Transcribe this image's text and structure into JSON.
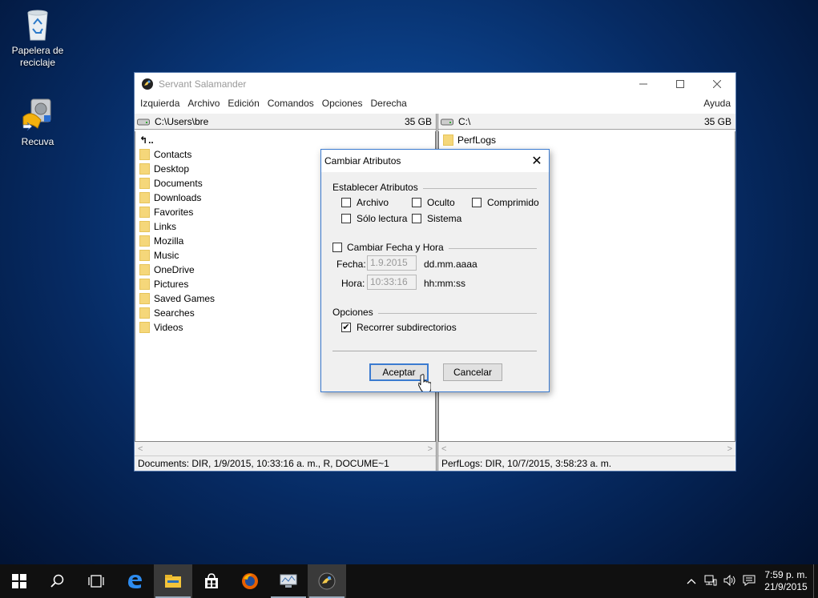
{
  "desktop": {
    "icons": [
      {
        "label": "Papelera de reciclaje"
      },
      {
        "label": "Recuva"
      }
    ]
  },
  "window": {
    "title": "Servant Salamander",
    "menu": [
      "Izquierda",
      "Archivo",
      "Edición",
      "Comandos",
      "Opciones",
      "Derecha"
    ],
    "menu_help": "Ayuda",
    "left": {
      "path": "C:\\Users\\bre",
      "free": "35 GB",
      "up": "..",
      "items": [
        "Contacts",
        "Desktop",
        "Documents",
        "Downloads",
        "Favorites",
        "Links",
        "Mozilla",
        "Music",
        "OneDrive",
        "Pictures",
        "Saved Games",
        "Searches",
        "Videos"
      ],
      "status": "Documents: DIR, 1/9/2015, 10:33:16 a. m., R, DOCUME~1"
    },
    "right": {
      "path": "C:\\",
      "free": "35 GB",
      "items": [
        "PerfLogs"
      ],
      "status": "PerfLogs: DIR, 10/7/2015, 3:58:23 a. m."
    }
  },
  "dialog": {
    "title": "Cambiar Atributos",
    "group_attrs": "Establecer Atributos",
    "attrs": {
      "archivo": "Archivo",
      "oculto": "Oculto",
      "comprimido": "Comprimido",
      "solo_lectura": "Sólo lectura",
      "sistema": "Sistema"
    },
    "change_date": "Cambiar Fecha y Hora",
    "fecha_label": "Fecha:",
    "fecha_value": "1.9.2015",
    "fecha_format": "dd.mm.aaaa",
    "hora_label": "Hora:",
    "hora_value": "10:33:16",
    "hora_format": "hh:mm:ss",
    "group_options": "Opciones",
    "recurse": "Recorrer subdirectorios",
    "recurse_checked": "✔",
    "ok": "Aceptar",
    "cancel": "Cancelar"
  },
  "taskbar": {
    "time": "7:59 p. m.",
    "date": "21/9/2015"
  },
  "colors": {
    "accent": "#3b7bd0",
    "folder": "#f5d77a",
    "taskbar": "#101010"
  }
}
